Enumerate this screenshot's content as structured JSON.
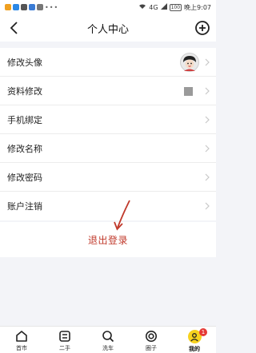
{
  "status_bar": {
    "signal_text": "4G",
    "battery": "100",
    "time": "晚上9:07"
  },
  "header": {
    "title": "个人中心",
    "icons": {
      "back": "chevron-left-icon",
      "add": "plus-circle-icon"
    }
  },
  "settings": {
    "items": [
      {
        "label": "修改头像",
        "extra": "avatar"
      },
      {
        "label": "资料修改",
        "extra": "gray-square"
      },
      {
        "label": "手机绑定"
      },
      {
        "label": "修改名称"
      },
      {
        "label": "修改密码"
      },
      {
        "label": "账户注销"
      }
    ]
  },
  "logout": {
    "label": "退出登录",
    "color": "#c0392b"
  },
  "tab_bar": {
    "tabs": [
      {
        "label": "首市",
        "icon": "home-icon"
      },
      {
        "label": "二手",
        "icon": "secondhand-icon"
      },
      {
        "label": "洗车",
        "icon": "search-icon"
      },
      {
        "label": "圈子",
        "icon": "target-icon"
      },
      {
        "label": "我的",
        "icon": "me-icon",
        "active": true
      }
    ],
    "badge_count": "1",
    "active_color": "#f7d21e"
  }
}
